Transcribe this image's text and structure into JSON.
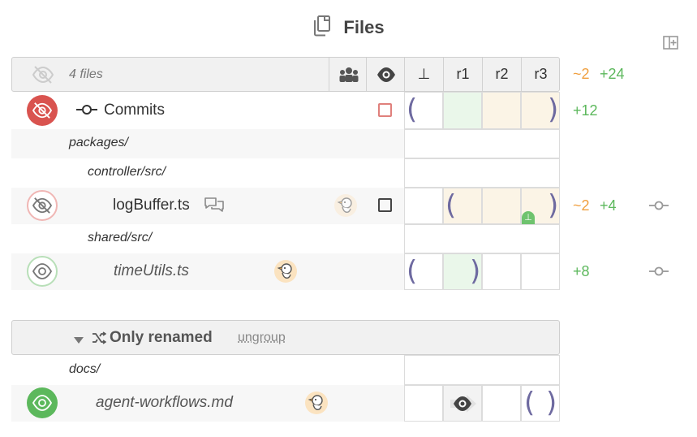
{
  "header": {
    "title": "Files"
  },
  "toolbar": {
    "files_count": "4 files",
    "columns": [
      "⊥",
      "r1",
      "r2",
      "r3"
    ],
    "stat_minus": "~2",
    "stat_plus": "+24"
  },
  "commits_row": {
    "label": "Commits",
    "stat_plus": "+12"
  },
  "tree": {
    "dir1": "packages/",
    "dir2": "controller/src/",
    "file1": {
      "name": "logBuffer.ts",
      "stat_minus": "~2",
      "stat_plus": "+4",
      "badge_text": "⊥"
    },
    "dir3": "shared/src/",
    "file2": {
      "name": "timeUtils.ts",
      "stat_plus": "+8"
    }
  },
  "group": {
    "title": "Only renamed",
    "ungroup_label": "ungroup",
    "dir": "docs/",
    "file": {
      "name": "agent-workflows.md"
    }
  },
  "colors": {
    "red": "#d9534f",
    "green": "#5cb85c",
    "orange": "#f0a040",
    "paren": "#6e6aa0"
  }
}
